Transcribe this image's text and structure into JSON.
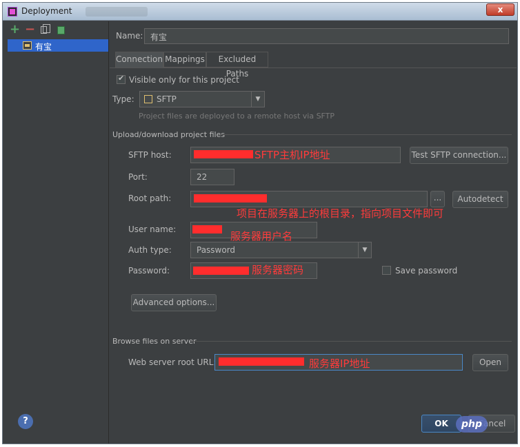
{
  "window": {
    "title": "Deployment",
    "close_label": "x"
  },
  "sidebar": {
    "toolbar": {
      "add_label": "+",
      "remove_label": "−"
    },
    "items": [
      {
        "label": "有宝"
      }
    ],
    "help_label": "?"
  },
  "name_field": {
    "label": "Name:",
    "value": "有宝"
  },
  "tabs": [
    {
      "label": "Connection",
      "active": true
    },
    {
      "label": "Mappings",
      "active": false
    },
    {
      "label": "Excluded Paths",
      "active": false
    }
  ],
  "visible_only": {
    "label": "Visible only for this project",
    "checked": true
  },
  "type_field": {
    "label": "Type:",
    "value": "SFTP",
    "hint": "Project files are deployed to a remote host via SFTP"
  },
  "upload_section": {
    "title": "Upload/download project files",
    "sftp_host_label": "SFTP host:",
    "test_button": "Test SFTP connection...",
    "port_label": "Port:",
    "port_value": "22",
    "root_path_label": "Root path:",
    "browse_button": "...",
    "autodetect_button": "Autodetect",
    "user_name_label": "User name:",
    "auth_type_label": "Auth type:",
    "auth_type_value": "Password",
    "password_label": "Password:",
    "save_password_label": "Save password",
    "save_password_checked": false,
    "advanced_button": "Advanced options..."
  },
  "browse_section": {
    "title": "Browse files on server",
    "web_root_label": "Web server root URL:",
    "open_button": "Open"
  },
  "annotations": {
    "sftp_host": "SFTP主机IP地址",
    "root_path": "项目在服务器上的根目录，指向项目文件即可",
    "user_name": "服务器用户名",
    "password": "服务器密码",
    "web_root": "服务器IP地址"
  },
  "footer": {
    "ok_button": "OK",
    "cancel_button": "Cancel",
    "watermark": "php"
  },
  "colors": {
    "background": "#3c3f41",
    "selection": "#2f65ca",
    "annotation": "#ff3b3b",
    "redaction": "#ff2d2d"
  }
}
